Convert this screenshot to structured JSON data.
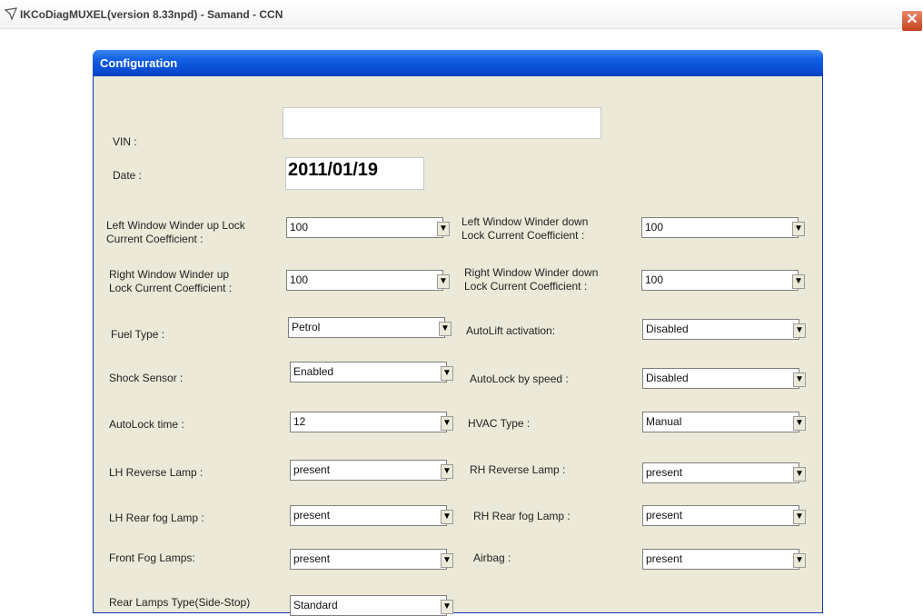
{
  "window": {
    "title": "IKCoDiagMUXEL(version 8.33npd) - Samand - CCN",
    "close_label": "✕"
  },
  "dialog": {
    "title": "Configuration"
  },
  "vin": {
    "label": "VIN :",
    "value": ""
  },
  "date": {
    "label": "Date :",
    "value": "2011/01/19"
  },
  "fields": {
    "lw_up": {
      "label1": "Left Window Winder up Lock",
      "label2": "Current Coefficient :",
      "value": "100"
    },
    "lw_down": {
      "label1": "Left Window Winder down",
      "label2": "Lock Current Coefficient :",
      "value": "100"
    },
    "rw_up": {
      "label1": "Right Window Winder up",
      "label2": "Lock Current Coefficient :",
      "value": "100"
    },
    "rw_down": {
      "label1": "Right Window Winder down",
      "label2": "Lock Current Coefficient :",
      "value": "100"
    },
    "fuel_type": {
      "label": "Fuel Type :",
      "value": "Petrol"
    },
    "autolift": {
      "label": "AutoLift activation:",
      "value": "Disabled"
    },
    "shock_sensor": {
      "label": "Shock Sensor :",
      "value": "Enabled"
    },
    "autolock_speed": {
      "label": "AutoLock by speed :",
      "value": "Disabled"
    },
    "autolock_time": {
      "label": "AutoLock time :",
      "value": "12"
    },
    "hvac_type": {
      "label": "HVAC Type :",
      "value": "Manual"
    },
    "lh_reverse": {
      "label": "LH Reverse Lamp :",
      "value": "present"
    },
    "rh_reverse": {
      "label": "RH Reverse Lamp :",
      "value": "present"
    },
    "lh_rear_fog": {
      "label": "LH Rear fog Lamp :",
      "value": "present"
    },
    "rh_rear_fog": {
      "label": "RH Rear fog Lamp :",
      "value": "present"
    },
    "front_fog": {
      "label": "Front Fog Lamps:",
      "value": "present"
    },
    "airbag": {
      "label": "Airbag :",
      "value": "present"
    },
    "rear_lamps_type": {
      "label": "Rear Lamps Type(Side-Stop)",
      "value": "Standard"
    }
  },
  "icons": {
    "app": "diagnostic-app-icon",
    "dropdown": "chevron-down-icon",
    "close": "close-icon"
  },
  "colors": {
    "titlebar_blue": "#0a4fd6",
    "dialog_bg": "#ece9d8",
    "close_red": "#c4411f"
  }
}
